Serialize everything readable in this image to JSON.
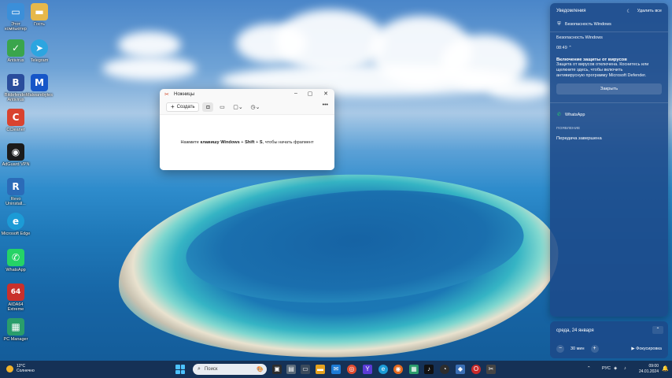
{
  "desktop": {
    "icons": [
      {
        "label": "Этот компьютер",
        "glyph": "▭",
        "color": "#3b8fd9"
      },
      {
        "label": "Гость",
        "glyph": "▬",
        "color": "#e6b84a"
      },
      {
        "label": "Antivirus",
        "glyph": "✓",
        "color": "#3aa54c"
      },
      {
        "label": "Telegram",
        "glyph": "➤",
        "color": "#2ca5e0"
      },
      {
        "label": "Bitdefender Antivirus",
        "glyph": "B",
        "color": "#2a4d9c"
      },
      {
        "label": "Malwarebytes",
        "glyph": "M",
        "color": "#1656c8"
      },
      {
        "label": "CCleaner",
        "glyph": "C",
        "color": "#d9432f"
      },
      {
        "label": "AdGuard VPN",
        "glyph": "◉",
        "color": "#1b1b1b"
      },
      {
        "label": "Revo Uninstall...",
        "glyph": "R",
        "color": "#2b6bb8"
      },
      {
        "label": "Microsoft Edge",
        "glyph": "e",
        "color": "#1c9bd6"
      },
      {
        "label": "WhatsApp",
        "glyph": "✆",
        "color": "#25d366"
      },
      {
        "label": "AIDA64 Extreme",
        "glyph": "64",
        "color": "#c9302c"
      },
      {
        "label": "PC Manager",
        "glyph": "▦",
        "color": "#2a9d6b"
      }
    ]
  },
  "snipping_tool": {
    "title": "Ножницы",
    "new_label": "Создать",
    "hint_before": "Нажмите ",
    "hint_key_windows": "клавишу Windows",
    "hint_plus1": " + ",
    "hint_key_shift": "Shift",
    "hint_plus2": " + ",
    "hint_key_s": "S",
    "hint_after": ", чтобы начать фрагмент",
    "icons": [
      "camera-icon",
      "video-icon",
      "rectangle-mode-icon",
      "timer-icon",
      "more-icon"
    ]
  },
  "notification_center": {
    "title": "Уведомления",
    "clear_all": "Удалить все",
    "security_app": "Безопасность Windows",
    "security_sub": "Безопасность Windows",
    "time": "08:49",
    "card_title": "Включение защиты от вирусов",
    "card_text_1": "Защита от вирусов отключена. Коснитесь или",
    "card_text_2": "щелкните здесь, чтобы включить",
    "card_text_3": "антивирусную программу Microsoft Defender.",
    "close_label": "Закрыть",
    "whatsapp_app": "WhatsApp",
    "whatsapp_sub": "ПОЯВЛЕНИЕ",
    "whatsapp_msg": "Передача завершена"
  },
  "calendar_panel": {
    "date": "среда, 24 января",
    "minutes": "30 мин",
    "focus_label": "Фокусировка"
  },
  "taskbar": {
    "temperature": "12°C",
    "weather": "Солнечно",
    "search_placeholder": "Поиск",
    "language": "РУС",
    "time": "09:00",
    "date": "24.01.2024"
  }
}
